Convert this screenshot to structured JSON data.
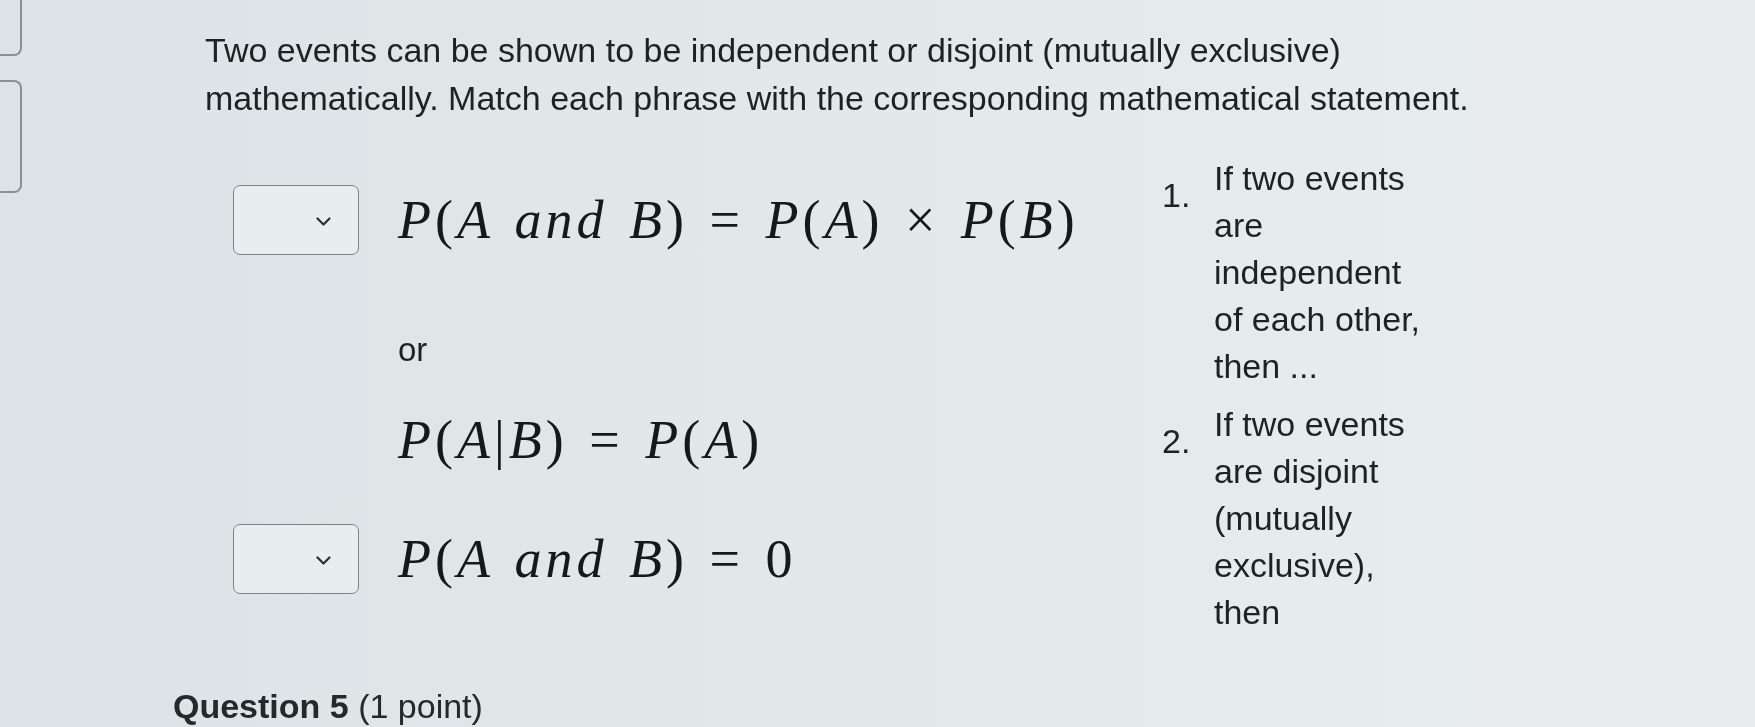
{
  "question": {
    "prompt": "Two events can be shown to be independent or disjoint (mutually exclusive) mathematically. Match each phrase with the corresponding mathematical statement."
  },
  "statements": [
    {
      "kind": "choice",
      "expression": "*P*(*A and B*) = *P*(*A*) × *P*(*B*)"
    },
    {
      "kind": "connector",
      "text": "or"
    },
    {
      "kind": "formula",
      "expression": "*P*(*A*|*B*) = *P*(*A*)"
    },
    {
      "kind": "choice",
      "expression": "*P*(*A and B*) = 0"
    }
  ],
  "phrases": [
    {
      "number": "1.",
      "text": "If two events are independent of each other, then ..."
    },
    {
      "number": "2.",
      "text": "If two events are disjoint (mutually exclusive), then"
    }
  ],
  "next_question": {
    "heading": "**Question 5** (1 point)"
  }
}
